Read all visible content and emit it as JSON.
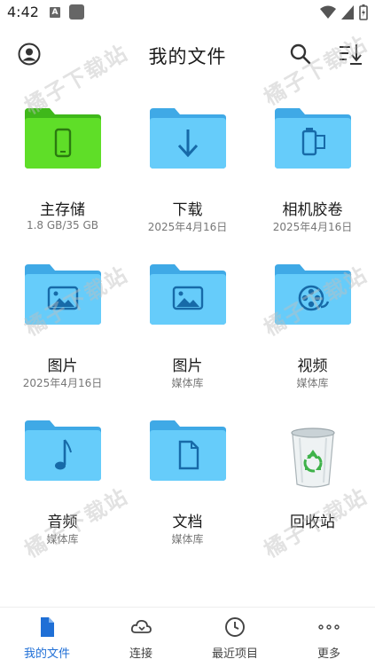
{
  "status_bar": {
    "time": "4:42",
    "notif_letter": "A"
  },
  "app_bar": {
    "title": "我的文件"
  },
  "tiles": [
    {
      "label": "主存储",
      "sub": "1.8 GB/35 GB",
      "icon": "phone-folder-icon",
      "color": "#57d624"
    },
    {
      "label": "下载",
      "sub": "2025年4月16日",
      "icon": "download-folder-icon",
      "color": "#5ec8f8"
    },
    {
      "label": "相机胶卷",
      "sub": "2025年4月16日",
      "icon": "camera-roll-folder-icon",
      "color": "#5ec8f8"
    },
    {
      "label": "图片",
      "sub": "2025年4月16日",
      "icon": "image-folder-icon",
      "color": "#5ec8f8"
    },
    {
      "label": "图片",
      "sub": "媒体库",
      "icon": "image-folder-icon",
      "color": "#5ec8f8"
    },
    {
      "label": "视频",
      "sub": "媒体库",
      "icon": "video-folder-icon",
      "color": "#5ec8f8"
    },
    {
      "label": "音频",
      "sub": "媒体库",
      "icon": "music-folder-icon",
      "color": "#5ec8f8"
    },
    {
      "label": "文档",
      "sub": "媒体库",
      "icon": "document-folder-icon",
      "color": "#5ec8f8"
    },
    {
      "label": "回收站",
      "sub": "",
      "icon": "recycle-bin-icon",
      "color": "#d0d8dc"
    }
  ],
  "watermark": "橘子下载站",
  "bottom_nav": [
    {
      "label": "我的文件",
      "icon": "file-icon",
      "active": true
    },
    {
      "label": "连接",
      "icon": "cloud-icon",
      "active": false
    },
    {
      "label": "最近项目",
      "icon": "clock-icon",
      "active": false
    },
    {
      "label": "更多",
      "icon": "more-dots-icon",
      "active": false
    }
  ],
  "colors": {
    "accent": "#1f6fd6",
    "folder_blue": "#5ec8f8",
    "folder_green": "#57d624"
  }
}
